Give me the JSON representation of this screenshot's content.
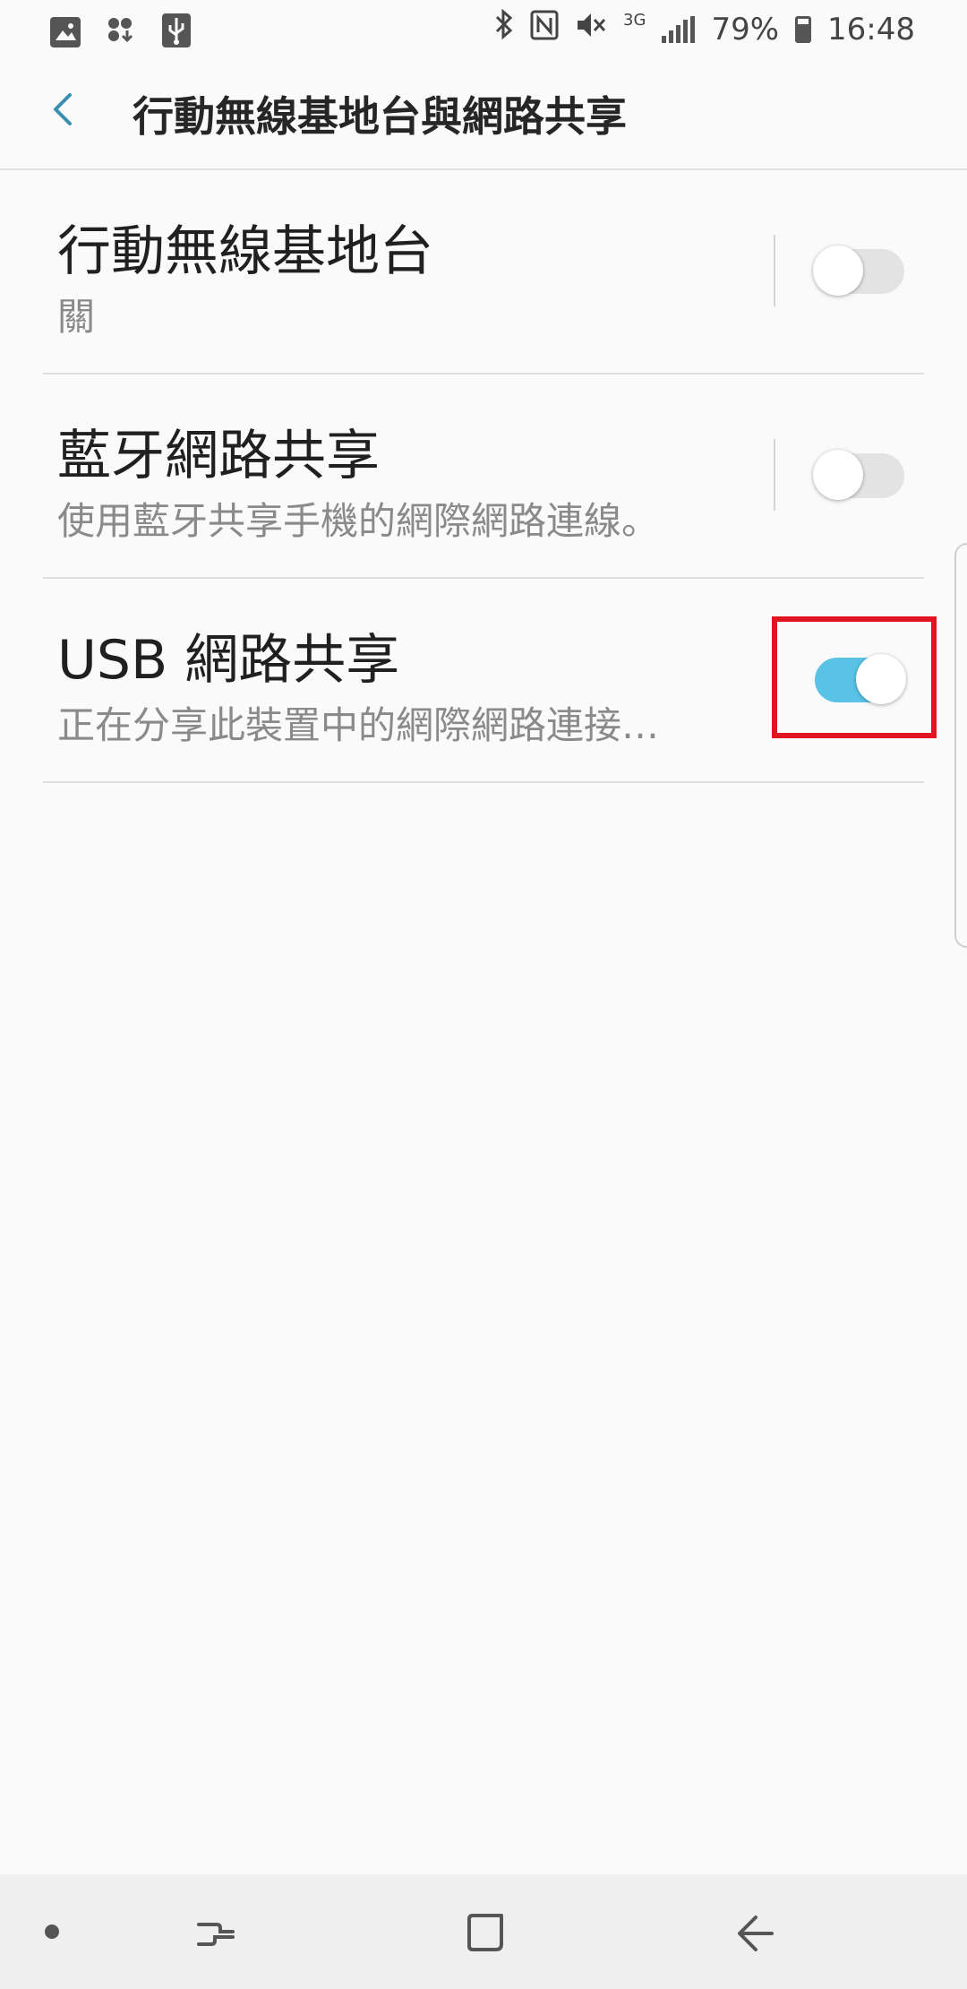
{
  "status_bar": {
    "left_icons": [
      "gallery-icon",
      "download-icon",
      "usb-icon"
    ],
    "right_icons": [
      "bluetooth-icon",
      "nfc-icon",
      "mute-icon"
    ],
    "network_type": "3G",
    "battery_percent": "79%",
    "time": "16:48"
  },
  "header": {
    "title": "行動無線基地台與網路共享",
    "back_icon": "chevron-left-icon"
  },
  "rows": [
    {
      "title": "行動無線基地台",
      "subtitle": "關",
      "enabled": false
    },
    {
      "title": "藍牙網路共享",
      "subtitle": "使用藍牙共享手機的網際網路連線。",
      "enabled": false
    },
    {
      "title": "USB 網路共享",
      "subtitle": "正在分享此裝置中的網際網路連接…",
      "enabled": true
    }
  ],
  "nav_bar": {
    "buttons": [
      "dot-icon",
      "recents-icon",
      "home-icon",
      "back-arrow-icon"
    ]
  },
  "colors": {
    "accent": "#59c3e6",
    "highlight": "#e0151f",
    "back_chevron": "#3a8fb0"
  }
}
